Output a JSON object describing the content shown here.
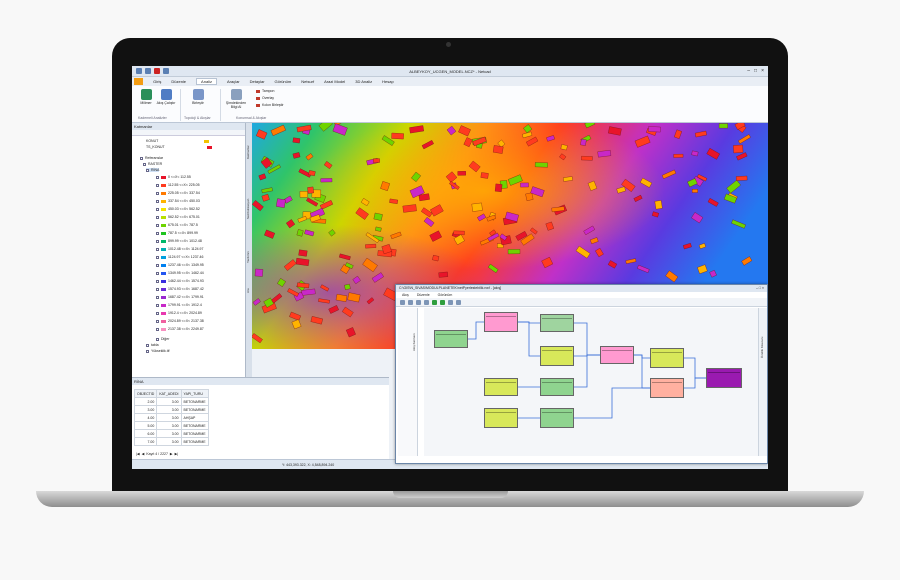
{
  "window": {
    "title": "ALBEYKOY_UCGEN_MODEL.NCZ* - Netcad"
  },
  "menu": {
    "file": "",
    "tabs": [
      "Giriş",
      "Düzenle",
      "Analiz",
      "Araçlar",
      "Detaylar",
      "Görünüm",
      "Netsurf",
      "Arazi Model",
      "3D Analiz",
      "Hesap"
    ],
    "active": "Analiz"
  },
  "ribbon": {
    "buttons": [
      {
        "label": "Milimer"
      },
      {
        "label": "Akış Çalıştır"
      },
      {
        "label": "Birleştir"
      },
      {
        "label": "Şimdekinden Bilgi Al"
      }
    ],
    "small_items": [
      "Tampon",
      "Overlay",
      "Kolon Birleştir"
    ],
    "groups": [
      "Kademeli Analizler",
      "Topoloji & Akışlar",
      "Konumsal & Akışlar"
    ]
  },
  "left_panel": {
    "title": "Katmanlar",
    "top_layers": [
      "KONUT",
      "TS_KONUT"
    ],
    "tree": [
      "Referanslar",
      "RASTER",
      "RİNA"
    ],
    "ranges": [
      {
        "label": "0 <=X< 112.55",
        "color": "#e8142a"
      },
      {
        "label": "112.55 <=X< 225.05",
        "color": "#ff3b1f"
      },
      {
        "label": "225.05 <=X< 337.54",
        "color": "#ff7a00"
      },
      {
        "label": "337.54 <=X< 450.03",
        "color": "#ffb400"
      },
      {
        "label": "450.03 <=X< 562.52",
        "color": "#f4e400"
      },
      {
        "label": "562.52 <=X< 675.01",
        "color": "#b8e000"
      },
      {
        "label": "675.01 <=X< 787.5",
        "color": "#6ed400"
      },
      {
        "label": "787.5 <=X< 899.99",
        "color": "#1fc41f"
      },
      {
        "label": "899.99 <=X< 1012.48",
        "color": "#00b86a"
      },
      {
        "label": "1012.48 <=X< 1124.97",
        "color": "#00b0b4"
      },
      {
        "label": "1124.97 <=X< 1237.46",
        "color": "#00a0e0"
      },
      {
        "label": "1237.46 <=X< 1349.95",
        "color": "#0080f0"
      },
      {
        "label": "1349.95 <=X< 1462.44",
        "color": "#2456f0"
      },
      {
        "label": "1462.44 <=X< 1574.93",
        "color": "#3a2ee0"
      },
      {
        "label": "1574.93 <=X< 1687.42",
        "color": "#6a2ad8"
      },
      {
        "label": "1687.42 <=X< 1799.91",
        "color": "#9a28d0"
      },
      {
        "label": "1799.91 <=X< 1912.4",
        "color": "#c828c8"
      },
      {
        "label": "1912.4 <=X< 2024.89",
        "color": "#e838b0"
      },
      {
        "label": "2024.89 <=X< 2137.38",
        "color": "#f060a0"
      },
      {
        "label": "2137.38 <=X< 2249.87",
        "color": "#f890c0"
      }
    ],
    "tail": [
      "Diğer",
      "tabla",
      "Yükseklik.tif"
    ]
  },
  "side_tabs": [
    "Katmanlar",
    "Sembolizasyon",
    "Yardımcı",
    "Ara"
  ],
  "table_panel": {
    "title": "RİNA",
    "columns": [
      "OBJECTID",
      "KAT_ADEDI",
      "YAPI_TURU"
    ],
    "rows": [
      [
        "2.00",
        "3.00",
        "BETONARME"
      ],
      [
        "3.00",
        "3.00",
        "BETONARME"
      ],
      [
        "4.00",
        "3.00",
        "AHŞAP"
      ],
      [
        "5.00",
        "3.00",
        "BETONARME"
      ],
      [
        "6.00",
        "3.00",
        "BETONARME"
      ],
      [
        "7.00",
        "3.00",
        "BETONARME"
      ]
    ],
    "record": "Kayıt 4 / 2227"
  },
  "status": {
    "coords": "Y: 443,393.322,  X: 4,548,894.240"
  },
  "dialog": {
    "title": "C:\\GIS\\N_SIVAS\\MODULPLANETEK\\netPyerlestebilik.nwf - [akış]",
    "menu": [
      "Akış",
      "Düzenle",
      "Görünüm"
    ],
    "right_tab": "Özellik Kılavuzu",
    "left_tab": "Akış Katmanı"
  },
  "colors": {
    "accent": "#f39c12",
    "ribbon": "#fbfcfe",
    "chrome": "#dfe7f1"
  }
}
